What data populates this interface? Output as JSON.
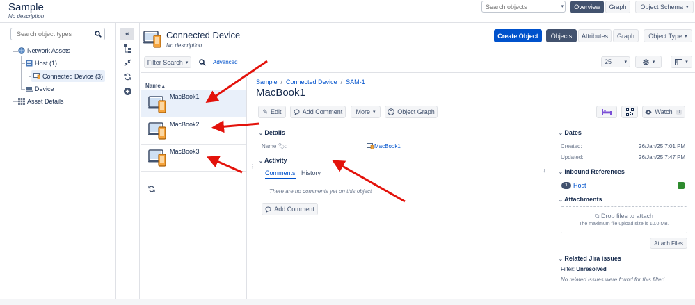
{
  "header": {
    "title": "Sample",
    "description": "No description",
    "search_placeholder": "Search objects",
    "tabs": [
      "Overview",
      "Graph"
    ],
    "schema_menu": "Object Schema"
  },
  "sidebar": {
    "search_placeholder": "Search object types",
    "tree": {
      "root": "Network Assets",
      "host": "Host (1)",
      "connected": "Connected Device (3)",
      "device": "Device",
      "asset_details": "Asset Details"
    }
  },
  "object_type": {
    "title": "Connected Device",
    "description": "No description",
    "create_button": "Create Object",
    "tabs": [
      "Objects",
      "Attributes",
      "Graph"
    ],
    "type_menu": "Object Type"
  },
  "toolbar": {
    "filter_label": "Filter Search",
    "advanced": "Advanced",
    "page_size": "25"
  },
  "list": {
    "header": "Name",
    "items": [
      "MacBook1",
      "MacBook2",
      "MacBook3"
    ]
  },
  "detail": {
    "breadcrumb": [
      "Sample",
      "Connected Device",
      "SAM-1"
    ],
    "title": "MacBook1",
    "actions": {
      "edit": "Edit",
      "add_comment": "Add Comment",
      "more": "More",
      "object_graph": "Object Graph",
      "watch": "Watch",
      "watch_count": "0"
    },
    "details_title": "Details",
    "name_label": "Name",
    "name_value": "MacBook1",
    "activity_title": "Activity",
    "activity_tabs": [
      "Comments",
      "History"
    ],
    "empty_comments": "There are no comments yet on this object",
    "add_comment_button": "Add Comment"
  },
  "right_panel": {
    "dates_title": "Dates",
    "created_label": "Created:",
    "created_value": "26/Jan/25 7:01 PM",
    "updated_label": "Updated:",
    "updated_value": "26/Jan/25 7:47 PM",
    "inbound_title": "Inbound References",
    "inbound_count": "1",
    "inbound_name": "Host",
    "attachments_title": "Attachments",
    "drop_text": "Drop files to attach",
    "drop_sub": "The maximum file upload size is 10.0 MB.",
    "attach_button": "Attach Files",
    "jira_title": "Related Jira issues",
    "filter_label": "Filter:",
    "filter_value": "Unresolved",
    "jira_empty": "No related issues were found for this filter!"
  },
  "colors": {
    "accent": "#0052cc",
    "dark_button": "#42526e",
    "arrow_red": "#e3120b",
    "selected_row": "#e9f0fa",
    "host_status": "#2e8b2e"
  }
}
